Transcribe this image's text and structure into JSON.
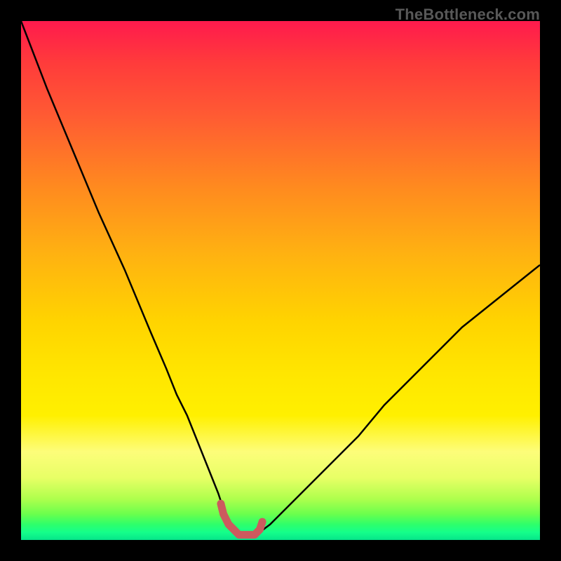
{
  "attribution": "TheBottleneck.com",
  "colors": {
    "frame": "#000000",
    "curve_stroke": "#000000",
    "highlight_stroke": "#cc5a5e",
    "gradient_top": "#ff1a4d",
    "gradient_bottom": "#06e58a"
  },
  "chart_data": {
    "type": "line",
    "title": "",
    "xlabel": "",
    "ylabel": "",
    "xlim": [
      0,
      100
    ],
    "ylim": [
      0,
      100
    ],
    "grid": false,
    "series": [
      {
        "name": "bottleneck-curve",
        "x": [
          0,
          5,
          10,
          15,
          20,
          25,
          28,
          30,
          32,
          34,
          36,
          38,
          39,
          40,
          41,
          42,
          43,
          44,
          45,
          46,
          48,
          50,
          55,
          60,
          65,
          70,
          75,
          80,
          85,
          90,
          95,
          100
        ],
        "values": [
          100,
          87,
          75,
          63,
          52,
          40,
          33,
          28,
          24,
          19,
          14,
          9,
          6,
          4,
          2.5,
          1.5,
          1,
          1,
          1,
          1.5,
          3,
          5,
          10,
          15,
          20,
          26,
          31,
          36,
          41,
          45,
          49,
          53
        ]
      },
      {
        "name": "optimal-range-highlight",
        "x": [
          38.5,
          39,
          40,
          41,
          42,
          43,
          44,
          45,
          46,
          46.5
        ],
        "values": [
          7,
          5,
          3,
          2,
          1,
          1,
          1,
          1,
          2,
          3.5
        ]
      }
    ],
    "annotations": []
  }
}
